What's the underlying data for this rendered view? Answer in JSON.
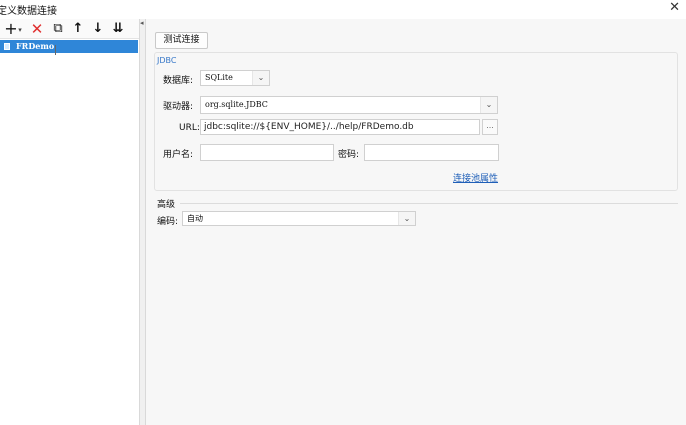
{
  "window": {
    "title": "定义数据连接"
  },
  "toolbar": {
    "icons": [
      "plus-icon",
      "dropdown-arrow-icon",
      "delete-icon",
      "copy-icon",
      "move-up-icon",
      "move-down-icon",
      "sort-icon"
    ],
    "add": "+",
    "add_arrow": "▾",
    "delete": "✕",
    "copy": "⧉",
    "up": "↑",
    "down": "↓",
    "sort": "⇊"
  },
  "tree": {
    "items": [
      {
        "label": "FRDemo",
        "selected": true
      }
    ]
  },
  "main": {
    "test_button": "测试连接",
    "jdbc": {
      "legend": "JDBC",
      "database_label": "数据库:",
      "database_value": "SQLite",
      "driver_label": "驱动器:",
      "driver_value": "org.sqlite.JDBC",
      "url_label": "URL:",
      "url_value": "jdbc:sqlite://${ENV_HOME}/../help/FRDemo.db",
      "url_button": "...",
      "username_label": "用户名:",
      "username_value": "",
      "password_label": "密码:",
      "password_value": "",
      "pool_link": "连接池属性"
    },
    "advanced": {
      "title": "高级",
      "encoding_label": "编码:",
      "encoding_value": "自动"
    }
  },
  "colors": {
    "selection": "#2f86d8",
    "link": "#1f5fb8",
    "legend": "#3878c8",
    "delete_icon": "#e03030"
  }
}
